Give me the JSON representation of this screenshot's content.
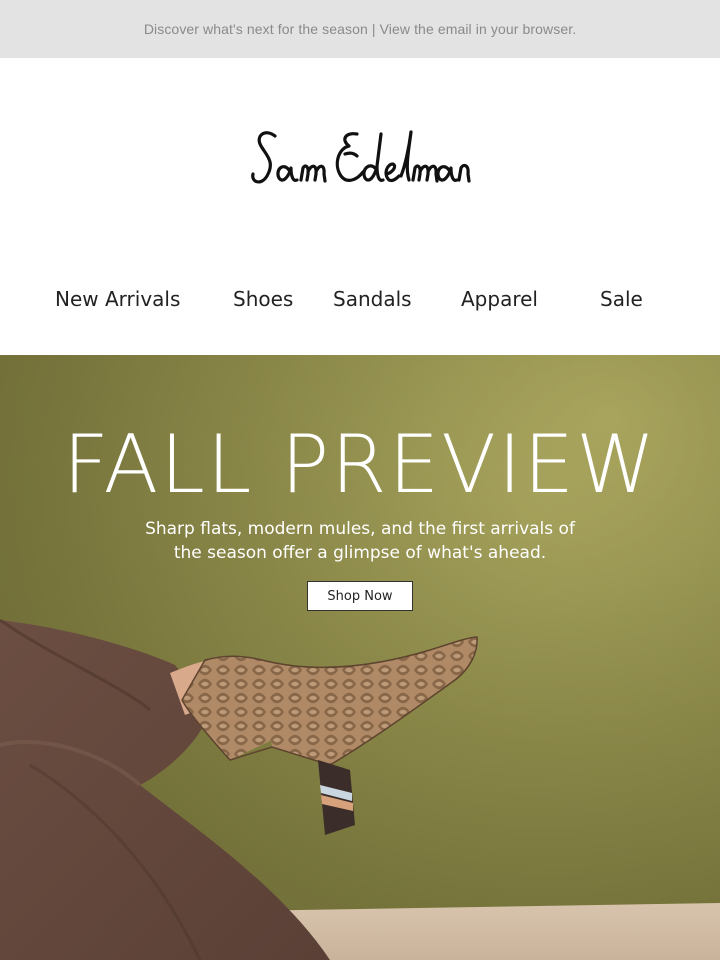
{
  "preheader": {
    "text": "Discover what's next for the season | View the email in your browser."
  },
  "brand": {
    "logo_text": "Sam Edelman"
  },
  "nav": {
    "items": [
      {
        "label": "New Arrivals"
      },
      {
        "label": "Shoes"
      },
      {
        "label": "Sandals"
      },
      {
        "label": "Apparel"
      },
      {
        "label": "Sale"
      }
    ]
  },
  "hero": {
    "title": "FALL PREVIEW",
    "subtitle_line1": "Sharp flats, modern mules, and the first arrivals of",
    "subtitle_line2": "the season offer a glimpse of what's ahead.",
    "cta_label": "Shop Now"
  },
  "colors": {
    "preheader_bg": "#e3e3e3",
    "hero_bg": "#8f8d4a",
    "text_dark": "#222222"
  }
}
